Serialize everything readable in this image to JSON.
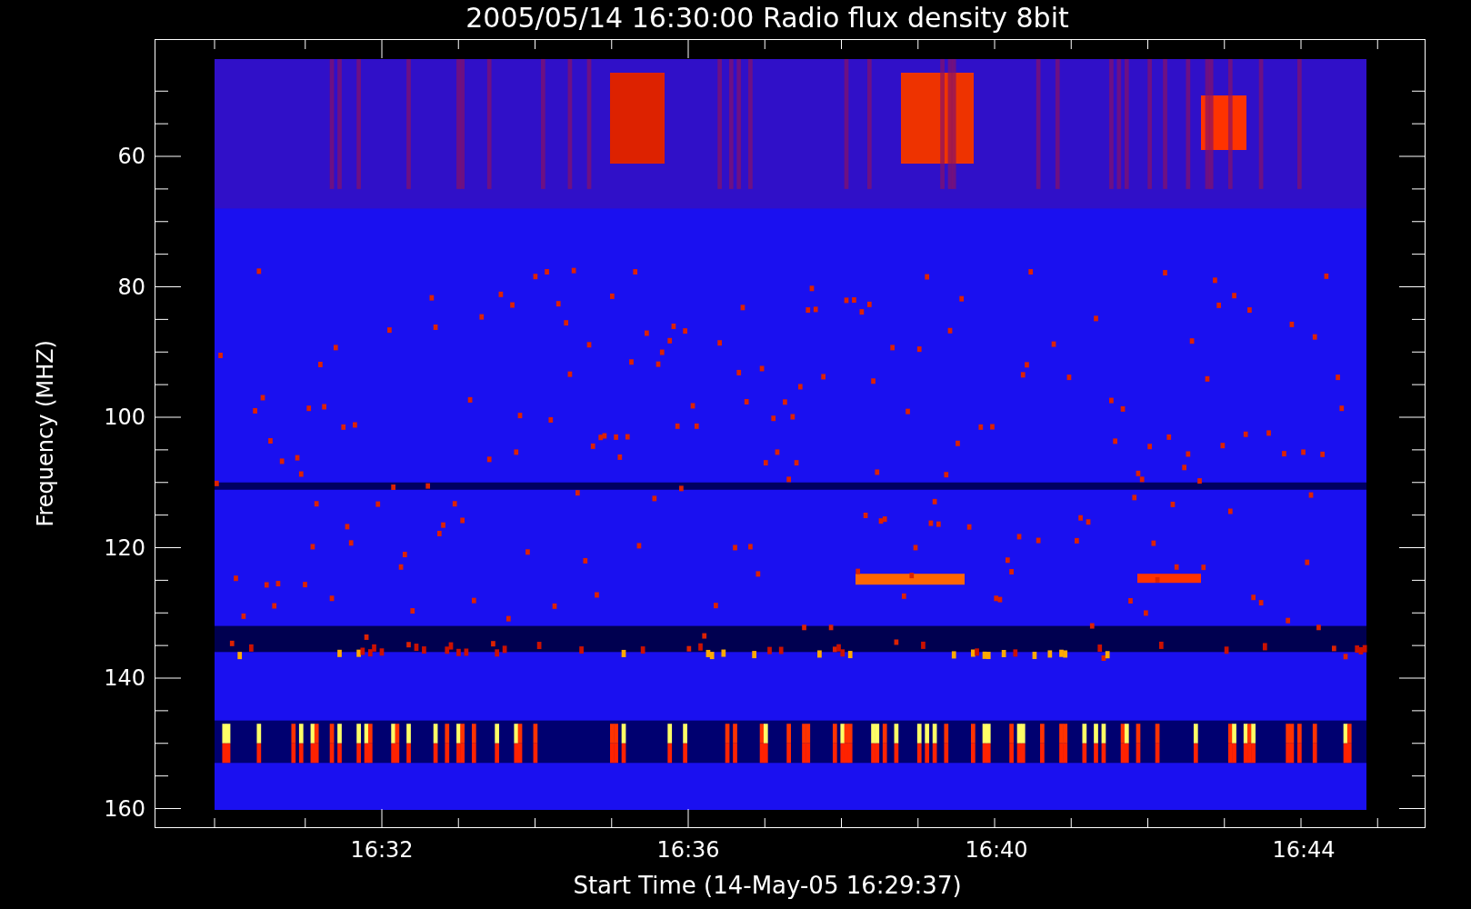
{
  "title": "2005/05/14 16:30:00 Radio flux density 8bit",
  "y_axis": {
    "label": "Frequency (MHZ)",
    "ticks": [
      "60",
      "80",
      "100",
      "120",
      "140",
      "160"
    ]
  },
  "x_axis": {
    "label": "Start Time (14-May-05 16:29:37)",
    "ticks": [
      "16:32",
      "16:36",
      "16:40",
      "16:44"
    ]
  }
}
